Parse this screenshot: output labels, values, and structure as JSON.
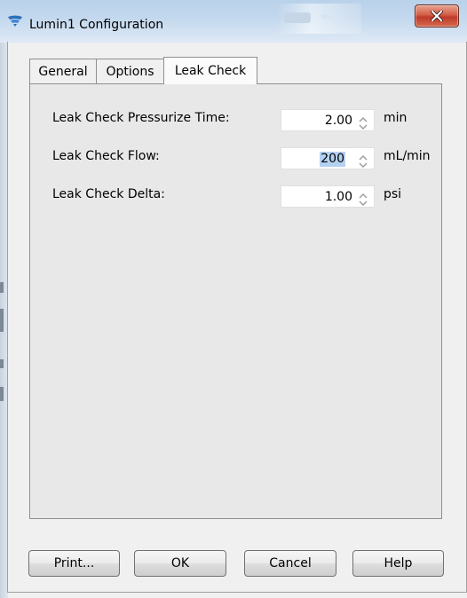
{
  "window": {
    "title": "Lumin1 Configuration"
  },
  "tabs": [
    {
      "label": "General",
      "active": false
    },
    {
      "label": "Options",
      "active": false
    },
    {
      "label": "Leak Check",
      "active": true
    }
  ],
  "leak_check": {
    "rows": [
      {
        "label": "Leak Check Pressurize Time:",
        "value": "2.00",
        "unit": "min",
        "selected": false
      },
      {
        "label": "Leak Check Flow:",
        "value": "200",
        "unit": "mL/min",
        "selected": true
      },
      {
        "label": "Leak Check Delta:",
        "value": "1.00",
        "unit": "psi",
        "selected": false
      }
    ]
  },
  "buttons": {
    "print": "Print...",
    "ok": "OK",
    "cancel": "Cancel",
    "help": "Help"
  },
  "colors": {
    "selection": "#b5d1f2",
    "close_button": "#c0392b",
    "panel_background": "#e8e8e8"
  }
}
